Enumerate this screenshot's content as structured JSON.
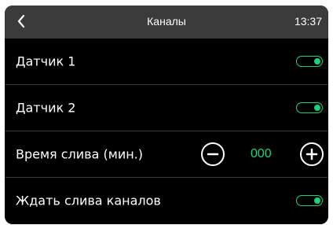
{
  "header": {
    "title": "Каналы",
    "time": "13:37"
  },
  "rows": [
    {
      "label": "Датчик 1",
      "toggle_on": true
    },
    {
      "label": "Датчик 2",
      "toggle_on": true
    },
    {
      "label": "Время слива (мин.)",
      "value": "000"
    },
    {
      "label": "Ждать слива каналов",
      "toggle_on": true
    }
  ],
  "icons": {
    "back": "chevron-left-icon",
    "minus": "minus-icon",
    "plus": "plus-icon"
  },
  "colors": {
    "accent": "#1ed07c",
    "header_bg": "#3b3b3b",
    "background": "#000000"
  }
}
